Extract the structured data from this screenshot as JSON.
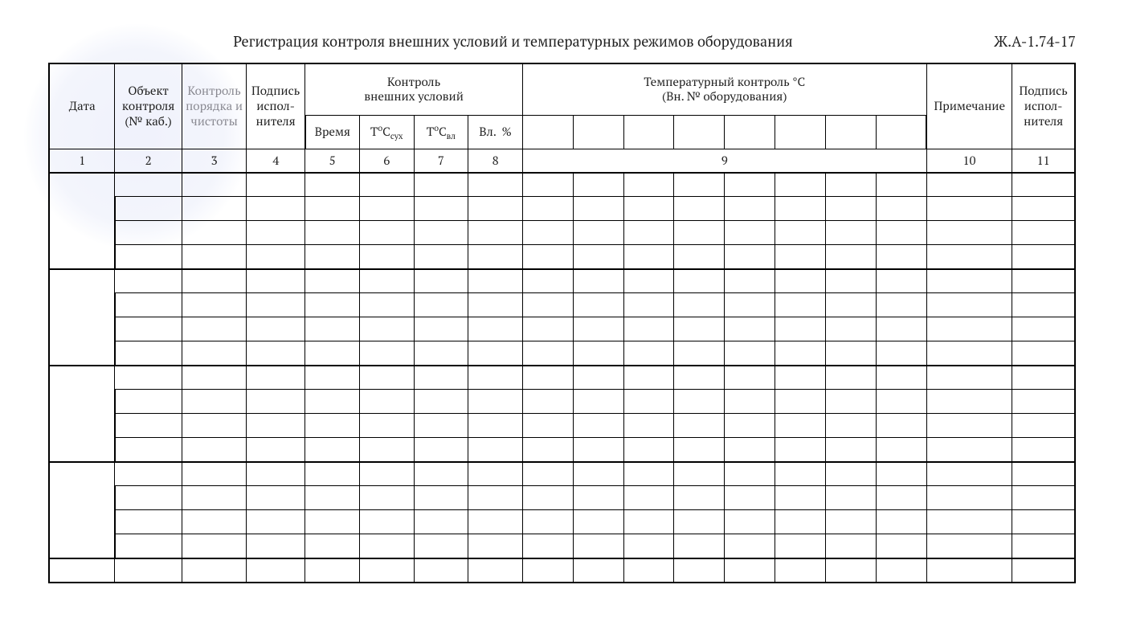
{
  "title": "Регистрация контроля внешних условий и температурных режимов оборудования",
  "doc_code": "Ж.А-1.74-17",
  "headers": {
    "date": "Дата",
    "object": "Объект контроля (№ каб.)",
    "cleanliness": "Контроль порядка и чистоты",
    "signature1": "Подпись испол-нителя",
    "env_group": "Контроль\nвнешних условий",
    "time": "Время",
    "t_dry_html": "Т<sup>о</sup>С<sub>сух</sub>",
    "t_wet_html": "Т<sup>о</sup>С<sub>вл</sub>",
    "humidity": "Вл.  %",
    "temp_group": "Температурный контроль °С\n(Вн. № оборудования)",
    "note": "Примечание",
    "signature2": "Подпись испол-нителя"
  },
  "col_numbers": [
    "1",
    "2",
    "3",
    "4",
    "5",
    "6",
    "7",
    "8",
    "9",
    "10",
    "11"
  ],
  "equipment_slots": 8,
  "body_groups": [
    4,
    4,
    4,
    4,
    1
  ]
}
